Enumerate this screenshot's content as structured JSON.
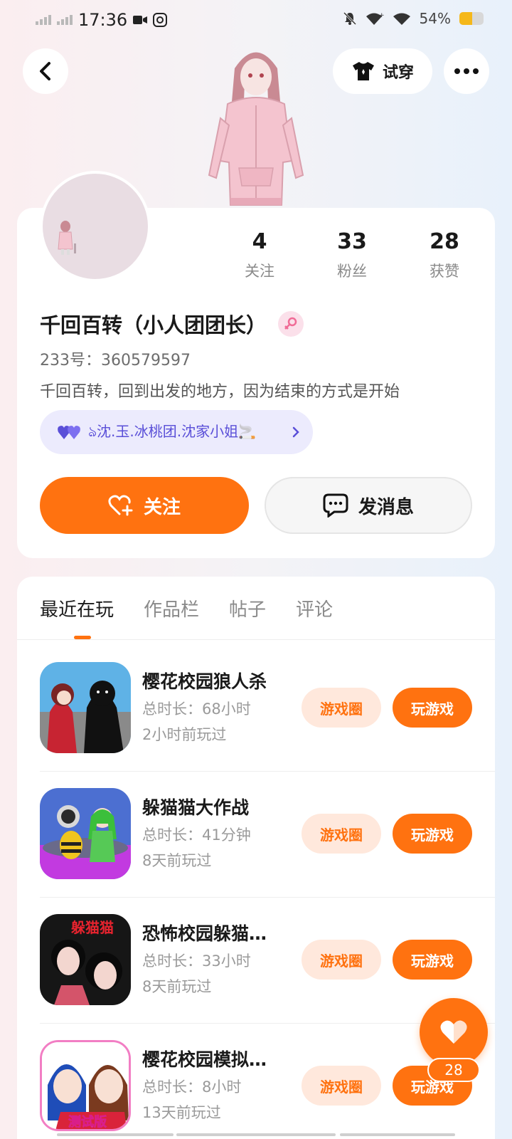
{
  "status_bar": {
    "time": "17:36",
    "battery": "54%",
    "battery_level": 0.54
  },
  "header": {
    "try_on_label": "试穿"
  },
  "profile": {
    "stats": [
      {
        "value": "4",
        "label": "关注"
      },
      {
        "value": "33",
        "label": "粉丝"
      },
      {
        "value": "28",
        "label": "获赞"
      }
    ],
    "name": "千回百转（小人团团长）",
    "uid": "233号：360579597",
    "bio": "千回百转，回到出发的地方，因为结束的方式是开始",
    "tag": "ঌ沈.玉.冰桃团.沈家小姐🚬",
    "follow_label": "关注",
    "message_label": "发消息"
  },
  "tabs": [
    {
      "label": "最近在玩",
      "active": true
    },
    {
      "label": "作品栏",
      "active": false
    },
    {
      "label": "帖子",
      "active": false
    },
    {
      "label": "评论",
      "active": false
    }
  ],
  "games": [
    {
      "title": "樱花校园狼人杀",
      "duration": "总时长：68小时",
      "last_played": "2小时前玩过",
      "circle_label": "游戏圈",
      "play_label": "玩游戏"
    },
    {
      "title": "躲猫猫大作战",
      "duration": "总时长：41分钟",
      "last_played": "8天前玩过",
      "circle_label": "游戏圈",
      "play_label": "玩游戏"
    },
    {
      "title": "恐怖校园躲猫…",
      "duration": "总时长：33小时",
      "last_played": "8天前玩过",
      "circle_label": "游戏圈",
      "play_label": "玩游戏"
    },
    {
      "title": "樱花校园模拟…",
      "duration": "总时长：8小时",
      "last_played": "13天前玩过",
      "circle_label": "游戏圈",
      "play_label": "玩游戏"
    }
  ],
  "thumbnail_captions": {
    "game3": "躲猫猫",
    "game4": "测试版"
  },
  "likes_fab": {
    "count": "28"
  },
  "colors": {
    "accent": "#ff7210",
    "accent_light": "#ffe8dc",
    "tag_bg": "#ecebfd",
    "tag_text": "#5a4fd8"
  }
}
